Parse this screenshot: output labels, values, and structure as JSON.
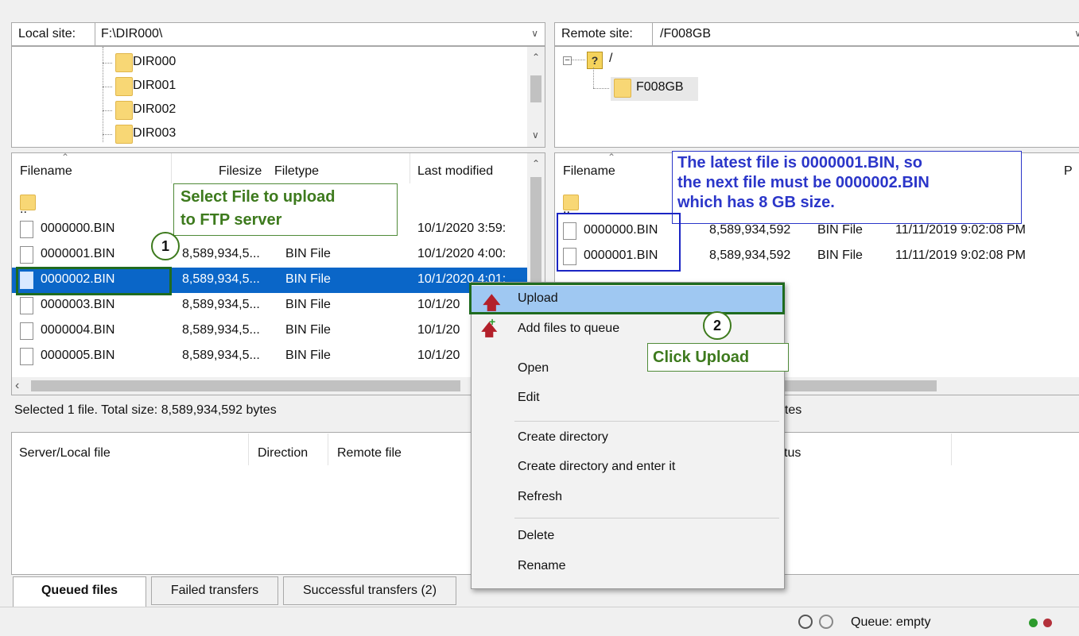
{
  "local_site": {
    "label": "Local site:",
    "path": "F:\\DIR000\\"
  },
  "remote_site": {
    "label": "Remote site:",
    "path": "/F008GB"
  },
  "local_tree": [
    "DIR000",
    "DIR001",
    "DIR002",
    "DIR003"
  ],
  "remote_tree": {
    "root": "/",
    "root_badge": "?",
    "child": "F008GB"
  },
  "local_list": {
    "headers": {
      "filename": "Filename",
      "filesize": "Filesize",
      "filetype": "Filetype",
      "modified": "Last modified"
    },
    "parent": "..",
    "rows": [
      {
        "name": "0000000.BIN",
        "size": "",
        "type": "",
        "modified": "10/1/2020 3:59:"
      },
      {
        "name": "0000001.BIN",
        "size": "8,589,934,5...",
        "type": "BIN File",
        "modified": "10/1/2020 4:00:"
      },
      {
        "name": "0000002.BIN",
        "size": "8,589,934,5...",
        "type": "BIN File",
        "modified": "10/1/2020 4:01:"
      },
      {
        "name": "0000003.BIN",
        "size": "8,589,934,5...",
        "type": "BIN File",
        "modified": "10/1/20"
      },
      {
        "name": "0000004.BIN",
        "size": "8,589,934,5...",
        "type": "BIN File",
        "modified": "10/1/20"
      },
      {
        "name": "0000005.BIN",
        "size": "8,589,934,5...",
        "type": "BIN File",
        "modified": "10/1/20"
      }
    ],
    "status": "Selected 1 file. Total size: 8,589,934,592 bytes"
  },
  "remote_list": {
    "headers": {
      "filename": "Filename",
      "extra": "P"
    },
    "parent": "..",
    "rows": [
      {
        "name": "0000000.BIN",
        "size": "8,589,934,592",
        "type": "BIN File",
        "modified": "11/11/2019 9:02:08 PM"
      },
      {
        "name": "0000001.BIN",
        "size": "8,589,934,592",
        "type": "BIN File",
        "modified": "11/11/2019 9:02:08 PM"
      }
    ],
    "status": "bytes"
  },
  "queue": {
    "headers": {
      "server_local": "Server/Local file",
      "direction": "Direction",
      "remote": "Remote file",
      "status": "tus"
    }
  },
  "tabs": {
    "queued": "Queued files",
    "failed": "Failed transfers",
    "successful": "Successful transfers (2)"
  },
  "statusbar": {
    "queue": "Queue: empty"
  },
  "context_menu": {
    "upload": "Upload",
    "add_queue": "Add files to queue",
    "open": "Open",
    "edit": "Edit",
    "create_dir": "Create directory",
    "create_dir_enter": "Create directory and enter it",
    "refresh": "Refresh",
    "delete": "Delete",
    "rename": "Rename"
  },
  "annotations": {
    "step1_num": "1",
    "step1_text_line1": "Select File to upload",
    "step1_text_line2": "to FTP server",
    "step2_num": "2",
    "step2_text": "Click Upload",
    "remote_note_line1": "The latest file is 0000001.BIN, so",
    "remote_note_line2": "the next file must be 0000002.BIN",
    "remote_note_line3": "which has 8 GB size."
  },
  "colors": {
    "selection": "#0a66c8",
    "annotation_green": "#3d7a1d",
    "annotation_blue": "#2b36c9",
    "upload_highlight": "#9fc8f2"
  }
}
